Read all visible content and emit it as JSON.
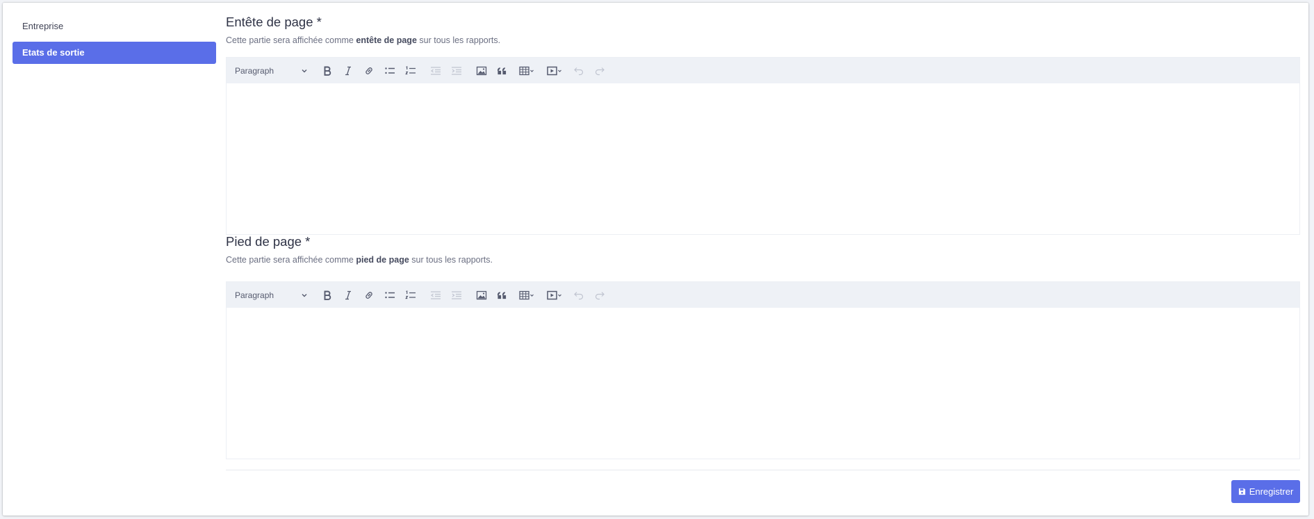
{
  "sidebar": {
    "items": [
      {
        "label": "Entreprise",
        "active": false
      },
      {
        "label": "Etats de sortie",
        "active": true
      }
    ]
  },
  "header_section": {
    "title": "Entête de page *",
    "help_prefix": "Cette partie sera affichée comme ",
    "help_bold": "entête de page",
    "help_suffix": " sur tous les rapports.",
    "editor": {
      "format_select": "Paragraph",
      "content": ""
    }
  },
  "footer_section": {
    "title": "Pied de page *",
    "help_prefix": "Cette partie sera affichée comme ",
    "help_bold": "pied de page",
    "help_suffix": " sur tous les rapports.",
    "editor": {
      "format_select": "Paragraph",
      "content": ""
    }
  },
  "toolbar_icons": [
    "bold-icon",
    "italic-icon",
    "link-icon",
    "bulleted-list-icon",
    "numbered-list-icon",
    "outdent-icon",
    "indent-icon",
    "image-icon",
    "blockquote-icon",
    "table-icon",
    "media-icon",
    "undo-icon",
    "redo-icon"
  ],
  "actions": {
    "save_label": "Enregistrer"
  },
  "colors": {
    "accent": "#5a6ee8",
    "toolbar_bg": "#eef1f6",
    "page_bg": "#f1f3f7"
  }
}
